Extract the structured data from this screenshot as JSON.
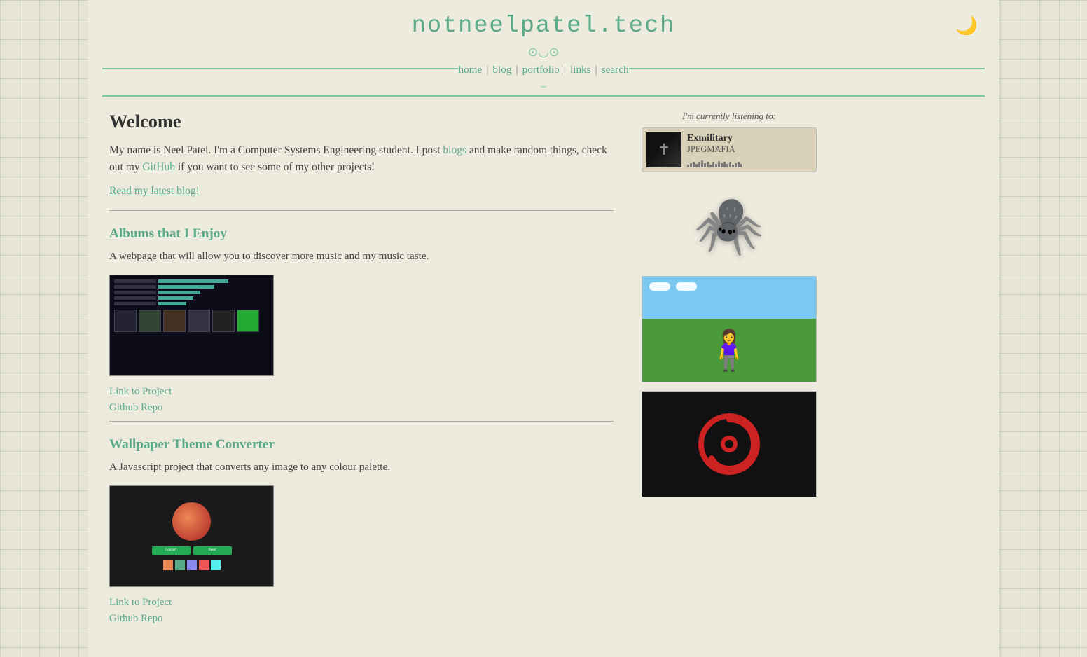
{
  "header": {
    "site_title": "notneelpatel.tech",
    "moon": "🌙",
    "nav_items": [
      {
        "label": "home",
        "href": "#"
      },
      {
        "label": "blog",
        "href": "#"
      },
      {
        "label": "portfolio",
        "href": "#"
      },
      {
        "label": "links",
        "href": "#"
      },
      {
        "label": "search",
        "href": "#"
      }
    ]
  },
  "main": {
    "welcome": {
      "heading": "Welcome",
      "text_before_link": "My name is Neel Patel. I'm a Computer Systems Engineering student. I post ",
      "blogs_link_label": "blogs",
      "text_after_link": " and make random things, check out my ",
      "github_link_label": "GitHub",
      "text_end": " if you want to see some of my other projects!",
      "read_blog_label": "Read my latest blog!"
    },
    "projects": [
      {
        "id": "albums",
        "title": "Albums that I Enjoy",
        "desc": "A webpage that will allow you to discover more music and my music taste.",
        "link_project_label": "Link to Project",
        "link_repo_label": "Github Repo"
      },
      {
        "id": "wallpaper",
        "title": "Wallpaper Theme Converter",
        "desc": "A Javascript project that converts any image to any colour palette.",
        "link_project_label": "Link to Project",
        "link_repo_label": "Github Repo"
      }
    ]
  },
  "sidebar": {
    "listening_label": "I'm currently listening to:",
    "now_playing": {
      "track_title": "Exmilitary",
      "artist": "JPEGMAFIA"
    }
  },
  "waveform_heights": [
    4,
    6,
    8,
    5,
    7,
    10,
    6,
    8,
    4,
    7,
    5,
    9,
    6,
    8,
    5,
    7,
    4,
    6,
    8,
    5
  ]
}
